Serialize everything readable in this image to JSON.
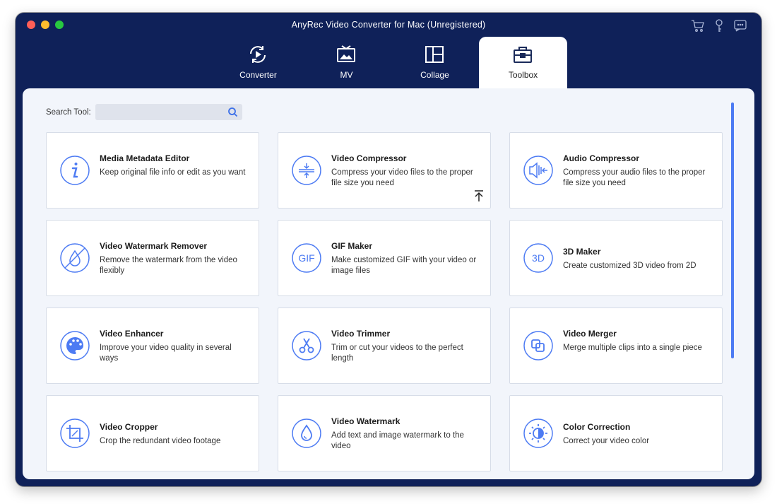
{
  "window": {
    "title": "AnyRec Video Converter for Mac (Unregistered)",
    "top_icons": [
      "cart-icon",
      "key-icon",
      "feedback-icon"
    ]
  },
  "tabs": [
    {
      "label": "Converter",
      "icon": "converter-icon",
      "active": false
    },
    {
      "label": "MV",
      "icon": "mv-icon",
      "active": false
    },
    {
      "label": "Collage",
      "icon": "collage-icon",
      "active": false
    },
    {
      "label": "Toolbox",
      "icon": "toolbox-icon",
      "active": true
    }
  ],
  "search": {
    "label": "Search Tool:",
    "value": "",
    "placeholder": ""
  },
  "tools": [
    {
      "name": "Media Metadata Editor",
      "desc": "Keep original file info or edit as you want",
      "icon": "info-icon"
    },
    {
      "name": "Video Compressor",
      "desc": "Compress your video files to the proper file size you need",
      "icon": "compress-icon"
    },
    {
      "name": "Audio Compressor",
      "desc": "Compress your audio files to the proper file size you need",
      "icon": "audio-compress-icon"
    },
    {
      "name": "Video Watermark Remover",
      "desc": "Remove the watermark from the video flexibly",
      "icon": "watermark-remove-icon"
    },
    {
      "name": "GIF Maker",
      "desc": "Make customized GIF with your video or image files",
      "icon": "gif-icon"
    },
    {
      "name": "3D Maker",
      "desc": "Create customized 3D video from 2D",
      "icon": "3d-icon"
    },
    {
      "name": "Video Enhancer",
      "desc": "Improve your video quality in several ways",
      "icon": "palette-icon"
    },
    {
      "name": "Video Trimmer",
      "desc": "Trim or cut your videos to the perfect length",
      "icon": "scissors-icon"
    },
    {
      "name": "Video Merger",
      "desc": "Merge multiple clips into a single piece",
      "icon": "merge-icon"
    },
    {
      "name": "Video Cropper",
      "desc": "Crop the redundant video footage",
      "icon": "crop-icon"
    },
    {
      "name": "Video Watermark",
      "desc": "Add text and image watermark to the video",
      "icon": "watermark-icon"
    },
    {
      "name": "Color Correction",
      "desc": "Correct your video color",
      "icon": "color-correction-icon"
    }
  ],
  "colors": {
    "accent": "#4d7bf3",
    "header": "#0f2159",
    "content_bg": "#f2f5fb"
  }
}
